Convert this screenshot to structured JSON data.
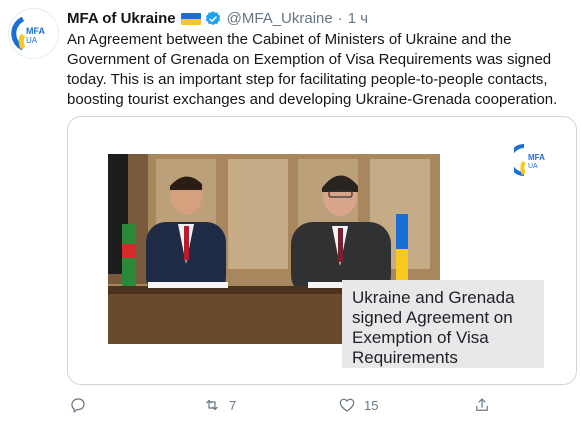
{
  "account": {
    "name": "MFA of Ukraine",
    "handle": "@MFA_Ukraine",
    "separator": "·",
    "time": "1 ч",
    "avatar_text": {
      "line1": "MFA",
      "line2": "UA"
    }
  },
  "tweet": {
    "text": "An Agreement between the Cabinet of Ministers of Ukraine and the Government of Grenada on Exemption of Visa Requirements was signed today. This is an important step for facilitating people-to-people contacts, boosting tourist exchanges and developing Ukraine-Grenada cooperation."
  },
  "media": {
    "caption": "Ukraine and Grenada signed Agreement on Exemption of Visa Requirements",
    "logo_text": {
      "line1": "MFA",
      "line2": "UA"
    }
  },
  "actions": {
    "reply_count": "",
    "retweet_count": "7",
    "like_count": "15"
  },
  "colors": {
    "brand_blue": "#1a6fd6",
    "brand_yellow": "#f7c81d",
    "text_primary": "#14171a",
    "text_secondary": "#657786",
    "verified_blue": "#1da1f2"
  },
  "icons": [
    "verified-badge-icon",
    "reply-icon",
    "retweet-icon",
    "like-icon",
    "share-icon"
  ]
}
